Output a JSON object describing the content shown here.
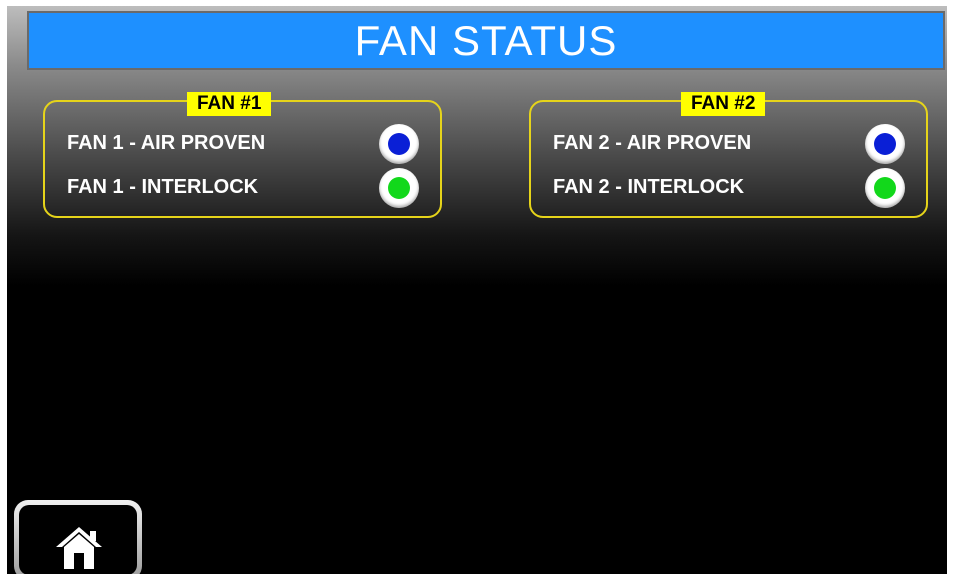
{
  "header": {
    "title": "FAN STATUS"
  },
  "panels": [
    {
      "tag": "FAN #1",
      "rows": [
        {
          "label": "FAN 1 - AIR PROVEN",
          "indicator_color": "#0a1fd6"
        },
        {
          "label": "FAN 1 - INTERLOCK",
          "indicator_color": "#12d81b"
        }
      ]
    },
    {
      "tag": "FAN #2",
      "rows": [
        {
          "label": "FAN 2 - AIR PROVEN",
          "indicator_color": "#0a1fd6"
        },
        {
          "label": "FAN 2 - INTERLOCK",
          "indicator_color": "#12d81b"
        }
      ]
    }
  ],
  "footer": {
    "home_icon": "home-icon"
  },
  "colors": {
    "title_bar": "#1e90ff",
    "panel_border": "#e6d41a",
    "tag_background": "#ffff00"
  }
}
